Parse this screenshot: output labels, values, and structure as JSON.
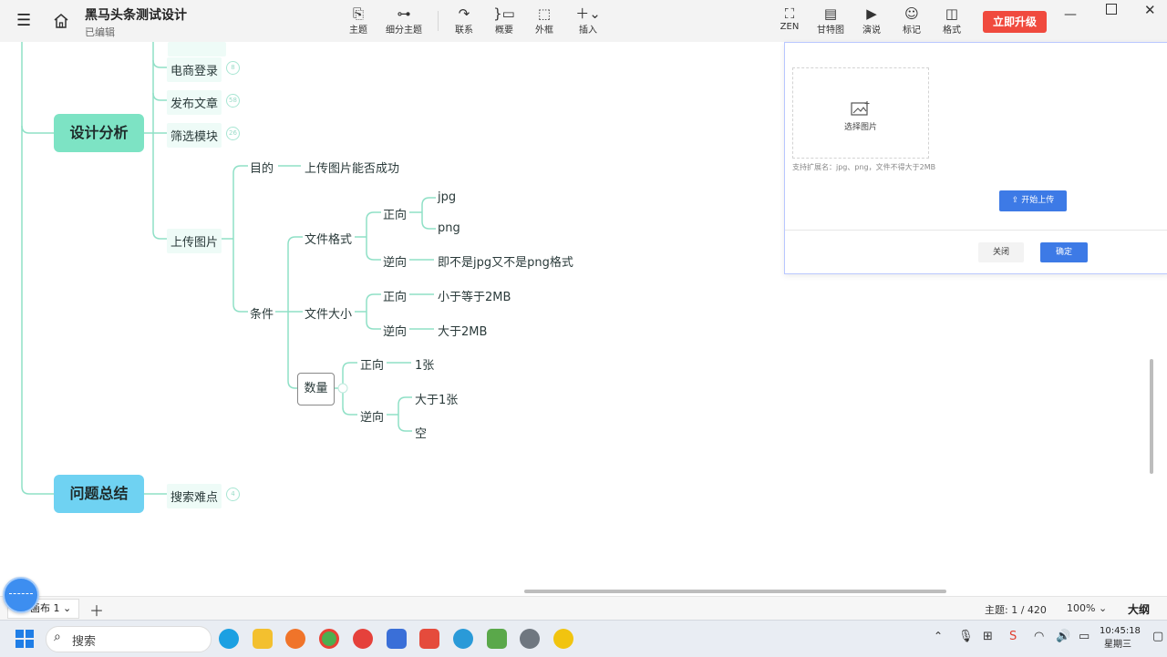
{
  "app": {
    "doc_title": "黑马头条测试设计",
    "doc_status": "已编辑",
    "upgrade_label": "立即升级"
  },
  "toolbar": [
    {
      "label": "主题",
      "icon": "topic-icon"
    },
    {
      "label": "细分主题",
      "icon": "subtopic-icon"
    },
    {
      "label": "联系",
      "icon": "relation-icon"
    },
    {
      "label": "概要",
      "icon": "summary-icon"
    },
    {
      "label": "外框",
      "icon": "boundary-icon"
    },
    {
      "label": "插入",
      "icon": "insert-icon"
    },
    {
      "label": "ZEN",
      "icon": "zen-icon"
    },
    {
      "label": "甘特图",
      "icon": "gantt-icon"
    },
    {
      "label": "演说",
      "icon": "present-icon"
    },
    {
      "label": "标记",
      "icon": "marker-icon"
    },
    {
      "label": "格式",
      "icon": "format-icon"
    }
  ],
  "mindmap": {
    "main_nodes": [
      "设计分析",
      "问题总结"
    ],
    "l2": [
      {
        "label": "电商登录",
        "badge": "8"
      },
      {
        "label": "发布文章",
        "badge": "58"
      },
      {
        "label": "筛选模块",
        "badge": "26"
      },
      {
        "label": "上传图片"
      },
      {
        "label": "搜索难点",
        "badge": "4"
      }
    ],
    "purpose": {
      "label": "目的",
      "value": "上传图片能否成功"
    },
    "condition": "条件",
    "file_format": {
      "label": "文件格式",
      "positive": "正向",
      "positive_items": [
        "jpg",
        "png"
      ],
      "negative": "逆向",
      "negative_item": "即不是jpg又不是png格式"
    },
    "file_size": {
      "label": "文件大小",
      "positive": "正向",
      "positive_item": "小于等于2MB",
      "negative": "逆向",
      "negative_item": "大于2MB"
    },
    "count": {
      "label": "数量",
      "positive": "正向",
      "positive_item": "1张",
      "negative": "逆向",
      "negative_items": [
        "大于1张",
        "空"
      ]
    }
  },
  "dialog": {
    "pick_label": "选择图片",
    "hint": "支持扩展名：jpg、png，文件不得大于2MB",
    "start_upload": "开始上传",
    "close": "关闭",
    "ok": "确定"
  },
  "status": {
    "sheet": "画布 1",
    "topic_count": "主题: 1 / 420",
    "zoom": "100%",
    "outline": "大纲"
  },
  "taskbar": {
    "search_placeholder": "搜索",
    "time": "10:45:18",
    "weekday": "星期三"
  },
  "colors": {
    "main_node_1": "#7de3c4",
    "main_node_2": "#6fd2f2",
    "branch_line": "#8fe0c6",
    "primary_button": "#3d7ae6",
    "upgrade": "#f04a3e"
  }
}
